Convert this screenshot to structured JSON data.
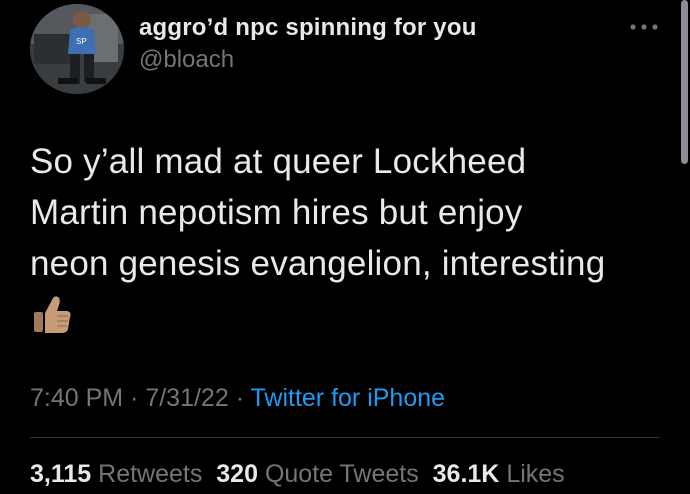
{
  "author": {
    "display_name": "aggro’d npc spinning for you",
    "handle": "@bloach",
    "avatar_icon": "profile-photo"
  },
  "tweet": {
    "lines": [
      "So y’all mad at queer Lockheed",
      "Martin nepotism hires but enjoy",
      "neon genesis evangelion, interesting"
    ],
    "emoji": "thumbs-up-medium-skin-tone"
  },
  "meta": {
    "time": "7:40 PM",
    "sep1": " · ",
    "date": "7/31/22",
    "sep2": " · ",
    "source": "Twitter for iPhone"
  },
  "stats": {
    "retweets_count": "3,115",
    "retweets_label": "Retweets",
    "quotes_count": "320",
    "quotes_label": "Quote Tweets",
    "likes_count": "36.1K",
    "likes_label": "Likes"
  },
  "colors": {
    "background": "#000000",
    "text": "#e7e9ea",
    "muted": "#71767b",
    "link": "#1d9bf0",
    "divider": "#2f3336"
  }
}
